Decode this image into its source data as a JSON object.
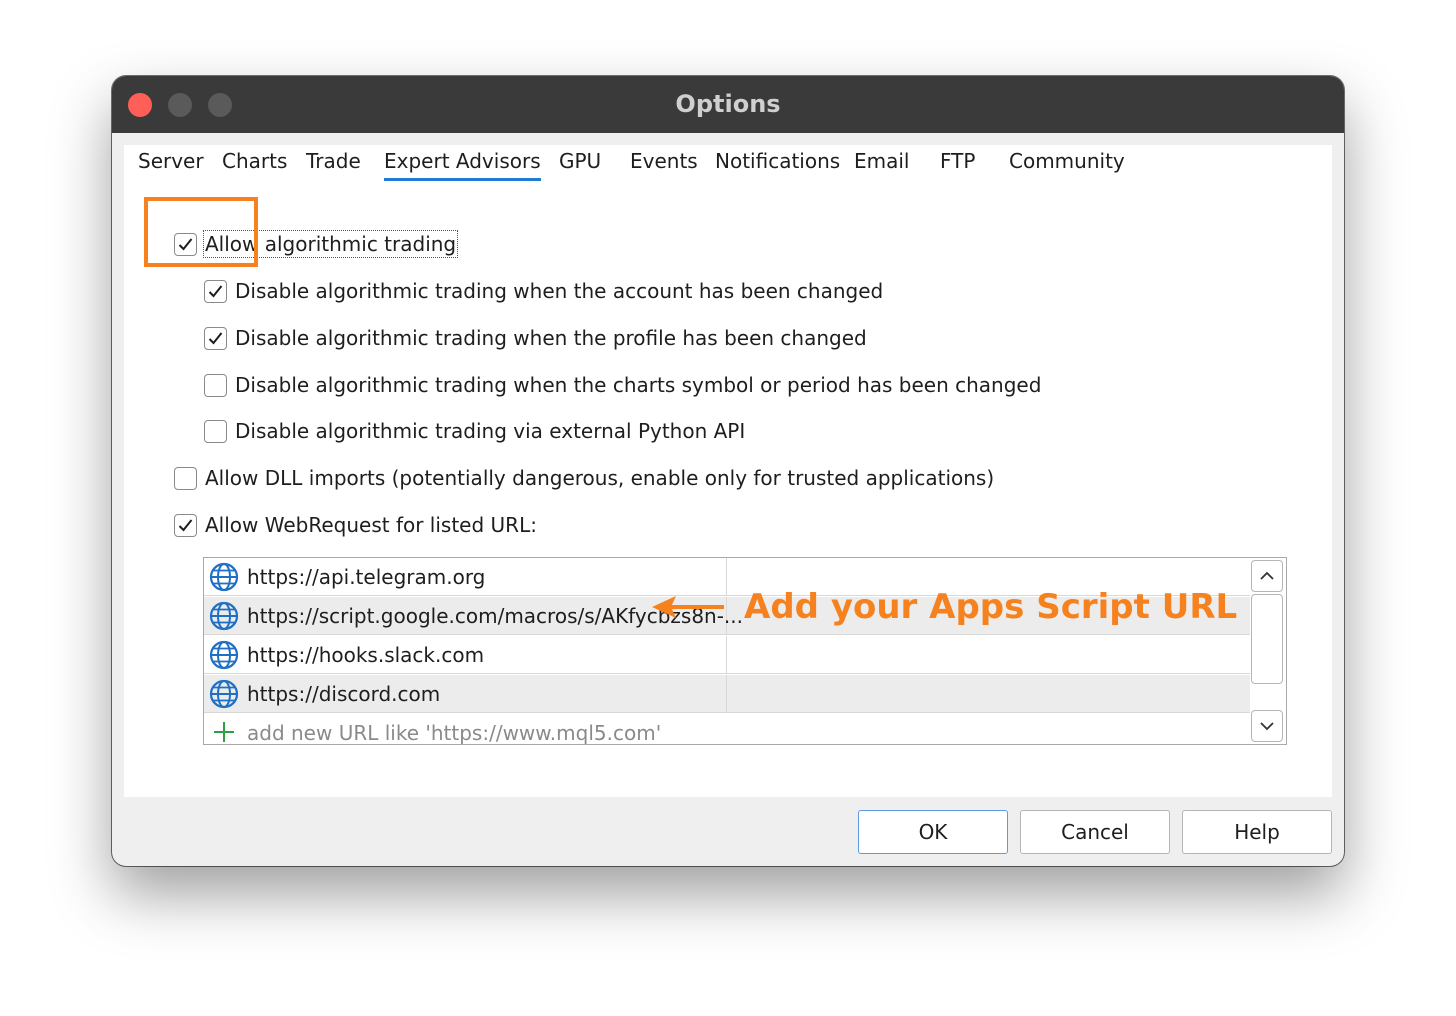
{
  "window": {
    "title": "Options"
  },
  "tabs": [
    {
      "label": "Server"
    },
    {
      "label": "Charts"
    },
    {
      "label": "Trade"
    },
    {
      "label": "Expert Advisors",
      "active": true
    },
    {
      "label": "GPU"
    },
    {
      "label": "Events"
    },
    {
      "label": "Notifications"
    },
    {
      "label": "Email"
    },
    {
      "label": "FTP"
    },
    {
      "label": "Community"
    }
  ],
  "options": {
    "allow_algo": {
      "label": "Allow algorithmic trading",
      "checked": true
    },
    "disable_account": {
      "label": "Disable algorithmic trading when the account has been changed",
      "checked": true
    },
    "disable_profile": {
      "label": "Disable algorithmic trading when the profile has been changed",
      "checked": true
    },
    "disable_symbol": {
      "label": "Disable algorithmic trading when the charts symbol or period has been changed",
      "checked": false
    },
    "disable_python": {
      "label": "Disable algorithmic trading via external Python API",
      "checked": false
    },
    "allow_dll": {
      "label": "Allow DLL imports (potentially dangerous, enable only for trusted applications)",
      "checked": false
    },
    "allow_webrequest": {
      "label": "Allow WebRequest for listed URL:",
      "checked": true
    }
  },
  "url_list": {
    "urls": [
      "https://api.telegram.org",
      "https://script.google.com/macros/s/AKfycbzs8n-...",
      "https://hooks.slack.com",
      "https://discord.com"
    ],
    "add_placeholder": "add new URL like 'https://www.mql5.com'"
  },
  "annotation": {
    "text": "Add your Apps Script URL",
    "color": "#f5821f"
  },
  "buttons": {
    "ok": "OK",
    "cancel": "Cancel",
    "help": "Help"
  },
  "colors": {
    "titlebar": "#3a3a3a",
    "close_button": "#ff5f57",
    "tab_underline": "#1f7bd6",
    "highlight": "#f5821f",
    "globe": "#1f6fc5",
    "plus": "#2ea043"
  }
}
